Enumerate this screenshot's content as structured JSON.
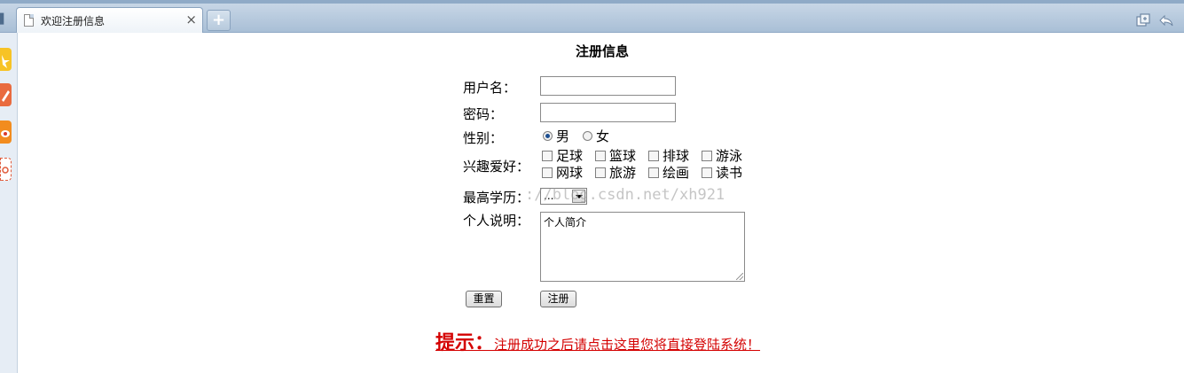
{
  "browser": {
    "tab_title": "欢迎注册信息",
    "tab_close": "×",
    "new_tab": "+"
  },
  "form": {
    "title": "注册信息",
    "username_label": "用户名：",
    "password_label": "密码：",
    "gender_label": "性别：",
    "gender_options": [
      {
        "label": "男",
        "checked": true
      },
      {
        "label": "女",
        "checked": false
      }
    ],
    "hobby_label": "兴趣爱好：",
    "hobbies": [
      "足球",
      "篮球",
      "排球",
      "游泳",
      "网球",
      "旅游",
      "绘画",
      "读书"
    ],
    "education_label": "最高学历：",
    "education_selected": "...",
    "bio_label": "个人说明：",
    "bio_value": "个人简介",
    "reset_button": "重置",
    "submit_button": "注册"
  },
  "watermark": "://blog.csdn.net/xh921",
  "hint": {
    "prefix": "提示：",
    "text": "注册成功之后请点击这里您将直接登陆系统！"
  },
  "colors": {
    "hint": "#d40000",
    "tabbar": "#a9bfd6",
    "sidebar": "#e6edf5"
  }
}
